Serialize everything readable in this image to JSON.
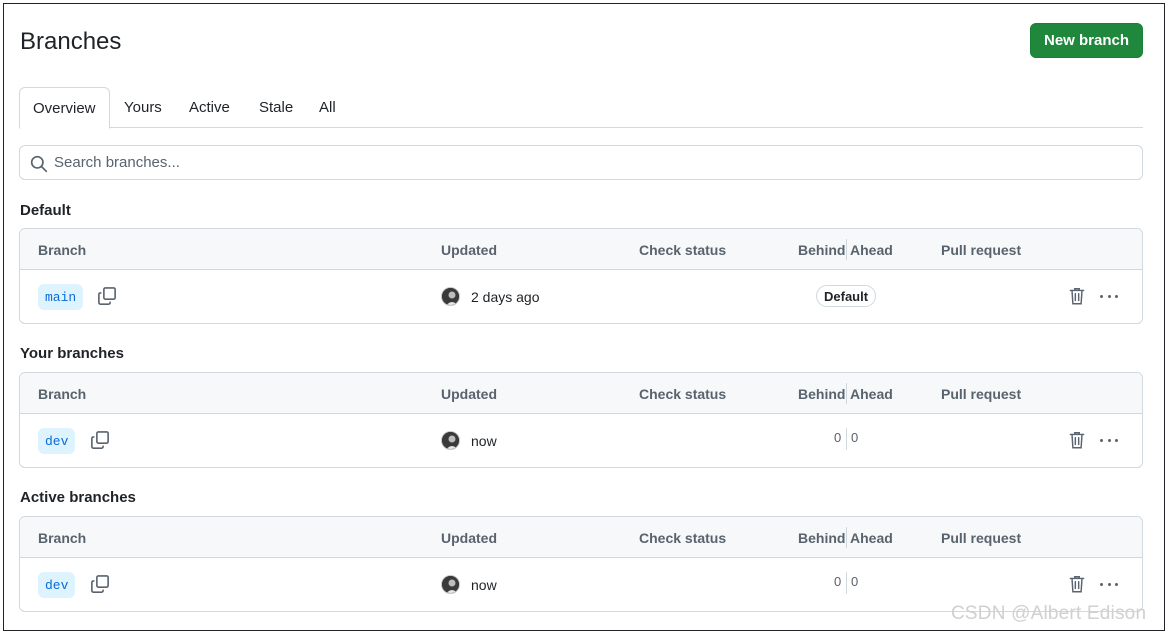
{
  "header": {
    "title": "Branches",
    "new_branch_label": "New branch"
  },
  "tabs": [
    {
      "label": "Overview",
      "selected": true
    },
    {
      "label": "Yours"
    },
    {
      "label": "Active"
    },
    {
      "label": "Stale"
    },
    {
      "label": "All"
    }
  ],
  "search": {
    "placeholder": "Search branches..."
  },
  "columns": {
    "branch": "Branch",
    "updated": "Updated",
    "check_status": "Check status",
    "behind": "Behind",
    "ahead": "Ahead",
    "pull_request": "Pull request"
  },
  "sections": [
    {
      "title": "Default",
      "rows": [
        {
          "branch": "main",
          "updated": "2 days ago",
          "badge": "Default"
        }
      ]
    },
    {
      "title": "Your branches",
      "rows": [
        {
          "branch": "dev",
          "updated": "now",
          "behind": "0",
          "ahead": "0"
        }
      ]
    },
    {
      "title": "Active branches",
      "rows": [
        {
          "branch": "dev",
          "updated": "now",
          "behind": "0",
          "ahead": "0"
        }
      ]
    }
  ],
  "watermark": "CSDN @Albert Edison",
  "colors": {
    "primary_button": "#1f883d",
    "branch_pill_bg": "#ddf4ff",
    "branch_pill_text": "#0969da"
  }
}
